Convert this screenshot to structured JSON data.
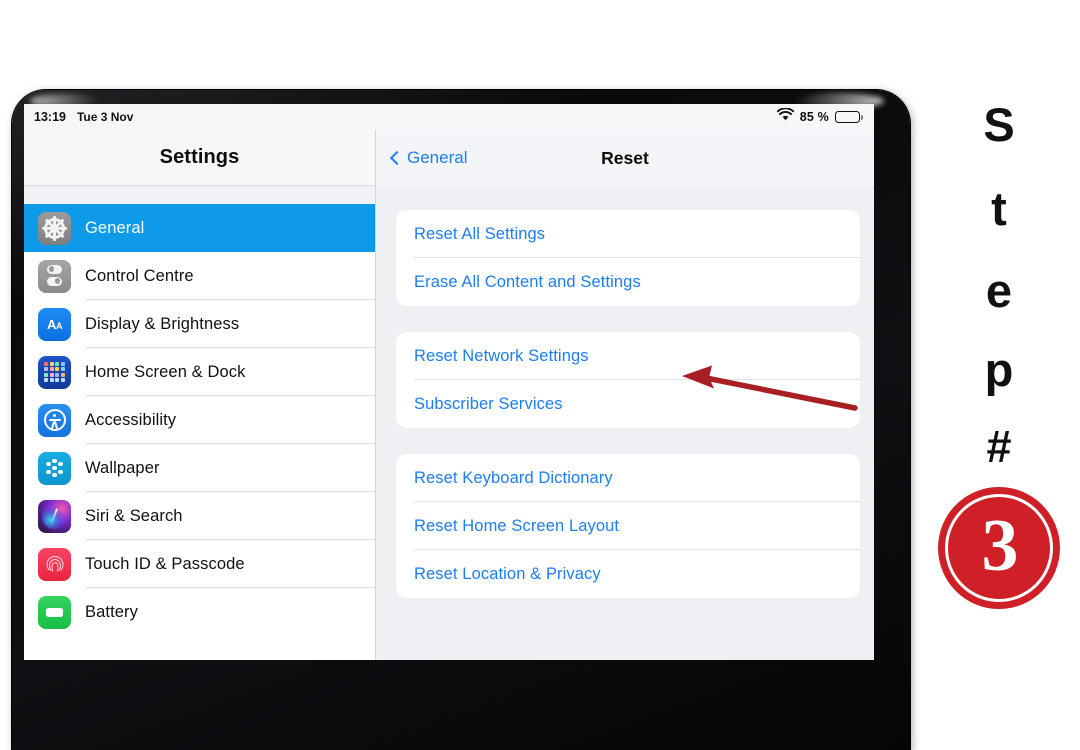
{
  "device": {
    "camera_icon": "front-camera-dot"
  },
  "status_bar": {
    "time": "13:19",
    "date": "Tue 3 Nov",
    "wifi_icon": "wifi-icon",
    "battery_percent": "85 %",
    "battery_icon": "battery-icon"
  },
  "sidebar": {
    "title": "Settings",
    "items": [
      {
        "label": "General",
        "icon": "gear-icon",
        "selected": true
      },
      {
        "label": "Control Centre",
        "icon": "control-centre-icon",
        "selected": false
      },
      {
        "label": "Display & Brightness",
        "icon": "display-brightness-icon",
        "selected": false
      },
      {
        "label": "Home Screen & Dock",
        "icon": "home-screen-dock-icon",
        "selected": false
      },
      {
        "label": "Accessibility",
        "icon": "accessibility-icon",
        "selected": false
      },
      {
        "label": "Wallpaper",
        "icon": "wallpaper-icon",
        "selected": false
      },
      {
        "label": "Siri & Search",
        "icon": "siri-search-icon",
        "selected": false
      },
      {
        "label": "Touch ID & Passcode",
        "icon": "touch-id-icon",
        "selected": false
      },
      {
        "label": "Battery",
        "icon": "battery-settings-icon",
        "selected": false
      }
    ]
  },
  "nav": {
    "back_label": "General",
    "back_icon": "chevron-left-icon",
    "title": "Reset"
  },
  "content": {
    "groups": [
      {
        "rows": [
          {
            "label": "Reset All Settings"
          },
          {
            "label": "Erase All Content and Settings"
          }
        ]
      },
      {
        "rows": [
          {
            "label": "Reset Network Settings"
          },
          {
            "label": "Subscriber Services"
          }
        ]
      },
      {
        "rows": [
          {
            "label": "Reset Keyboard Dictionary"
          },
          {
            "label": "Reset Home Screen Layout"
          },
          {
            "label": "Reset Location & Privacy"
          }
        ]
      }
    ]
  },
  "annotation": {
    "arrow_icon": "red-arrow-pointing-left",
    "arrow_color": "#a81f24",
    "target_label": "Erase All Content and Settings"
  },
  "step_label": {
    "letters": [
      "S",
      "t",
      "e",
      "p"
    ],
    "hash": "#",
    "number": "3",
    "badge_color": "#cf2027"
  },
  "colors": {
    "selection_blue": "#0d9ae8",
    "link_blue": "#1c7ef3",
    "content_background": "#eff0f4",
    "annotation_red": "#a81f24",
    "badge_red": "#cf2027"
  }
}
